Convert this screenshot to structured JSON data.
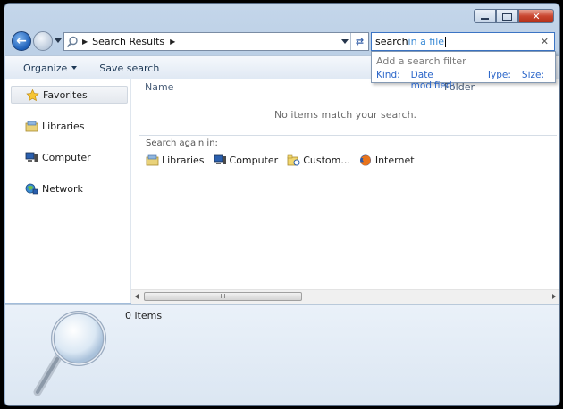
{
  "window": {
    "caption_buttons": {
      "minimize": "minimize-icon",
      "maximize": "maximize-icon",
      "close": "✕"
    }
  },
  "nav": {
    "back_icon": "back-arrow-icon",
    "forward_icon": "forward-arrow-icon"
  },
  "address": {
    "crumb": "Search Results",
    "icon": "search-folder-icon"
  },
  "search": {
    "typed": "search",
    "hint": " in a file",
    "clear": "✕"
  },
  "suggest": {
    "title": "Add a search filter",
    "filters": [
      "Kind:",
      "Date modified:",
      "Type:",
      "Size:"
    ]
  },
  "toolbar": {
    "organize": "Organize",
    "save_search": "Save search"
  },
  "sidebar": {
    "items": [
      {
        "label": "Favorites",
        "icon": "star-icon",
        "selected": true
      },
      {
        "label": "Libraries",
        "icon": "libraries-icon"
      },
      {
        "label": "Computer",
        "icon": "computer-icon"
      },
      {
        "label": "Network",
        "icon": "network-icon"
      }
    ]
  },
  "content": {
    "columns": [
      "Name",
      "Folder"
    ],
    "empty_message": "No items match your search.",
    "search_again_label": "Search again in:",
    "search_again": [
      {
        "label": "Libraries",
        "icon": "libraries-icon"
      },
      {
        "label": "Computer",
        "icon": "computer-icon"
      },
      {
        "label": "Custom...",
        "icon": "custom-folder-icon"
      },
      {
        "label": "Internet",
        "icon": "firefox-icon"
      }
    ],
    "scroll_grip": "III"
  },
  "details": {
    "count": "0 items",
    "icon": "magnifier-icon"
  },
  "colors": {
    "accent": "#3b74c4",
    "link": "#2b66c9",
    "close_red": "#c9462f"
  }
}
